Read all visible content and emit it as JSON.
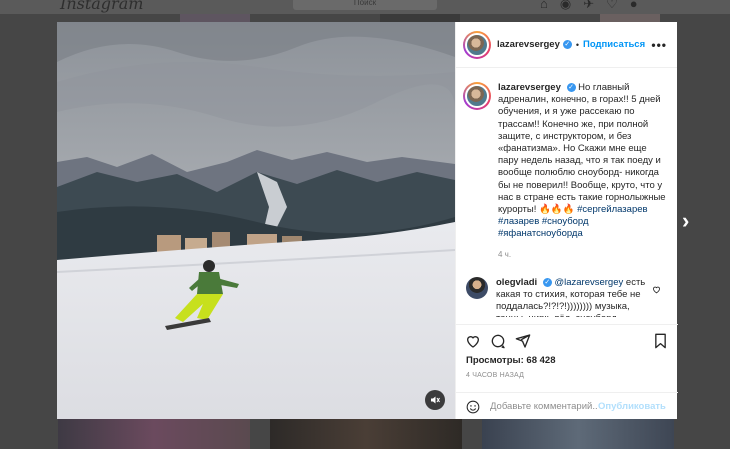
{
  "background": {
    "logo": "Instagram",
    "search_placeholder": "Поиск"
  },
  "post": {
    "username": "lazarevsergey",
    "follow_label": "Подписаться",
    "dot": "•",
    "verified_mark": "✓",
    "more_label": "•••",
    "caption": "Но главный адреналин, конечно, в горах!! 5 дней обучения, и я уже рассекаю по трассам!! Конечно же, при полной защите, с инструктором, и без «фанатизма». Но Скажи мне еще пару недель назад, что я так поеду и вообще полюблю сноуборд- никогда бы не поверил!! Вообще, круто, что у нас в стране есть такие горнолыжные курорты! 🔥🔥🔥",
    "hashtags": "#сергейлазарев #лазарев #сноуборд #яфанатсноуборда",
    "caption_time": "4 ч.",
    "views": "Просмотры: 68 428",
    "posted_ago": "4 ЧАСОВ НАЗАД"
  },
  "comment": {
    "username": "olegvladi",
    "mention": "@lazarevsergey",
    "text": " есть какая то стихия, которая тебе не поддалась?!?!?!)))))))) музыка, танцы, цирк, лёд, сноуборд,"
  },
  "comment_box": {
    "placeholder": "Добавьте комментарий...",
    "publish_label": "Опубликовать"
  },
  "icons": {
    "next": "chevron-right-icon",
    "like": "heart-icon",
    "comment": "comment-icon",
    "share": "share-icon",
    "save": "bookmark-icon",
    "mute": "mute-icon",
    "emoji": "emoji-icon"
  },
  "colors": {
    "accent": "#0095f6",
    "verified": "#3897f0",
    "hashtag": "#00376b",
    "muted": "#8e8e8e"
  }
}
